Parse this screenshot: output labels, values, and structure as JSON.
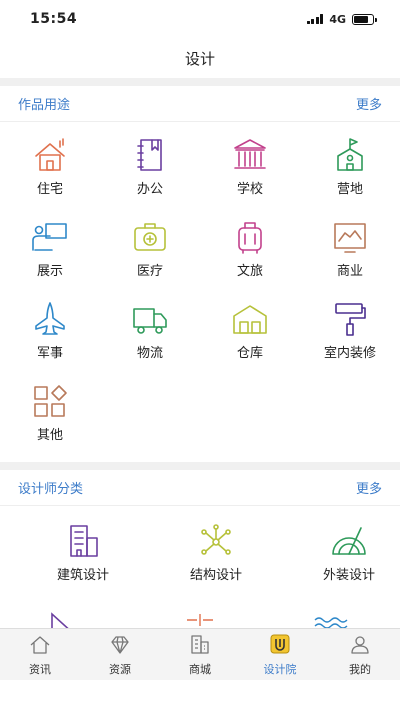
{
  "status_bar": {
    "time": "15:54",
    "network": "4G",
    "battery_level": 0.8
  },
  "nav": {
    "title": "设计"
  },
  "usage_section": {
    "title": "作品用途",
    "more": "更多",
    "items": [
      {
        "label": "住宅",
        "icon": "house-icon",
        "color": "#e0714d"
      },
      {
        "label": "办公",
        "icon": "notebook-icon",
        "color": "#6a3fa0"
      },
      {
        "label": "学校",
        "icon": "school-building-icon",
        "color": "#c2418c"
      },
      {
        "label": "营地",
        "icon": "camp-flag-icon",
        "color": "#2e9a5a"
      },
      {
        "label": "展示",
        "icon": "presentation-icon",
        "color": "#2e88c9"
      },
      {
        "label": "医疗",
        "icon": "medical-kit-icon",
        "color": "#b6c13a"
      },
      {
        "label": "文旅",
        "icon": "luggage-icon",
        "color": "#c2418c"
      },
      {
        "label": "商业",
        "icon": "screen-chart-icon",
        "color": "#b8795a"
      },
      {
        "label": "军事",
        "icon": "jet-icon",
        "color": "#2e88c9"
      },
      {
        "label": "物流",
        "icon": "truck-icon",
        "color": "#2e9a5a"
      },
      {
        "label": "仓库",
        "icon": "warehouse-icon",
        "color": "#b6c13a"
      },
      {
        "label": "室内装修",
        "icon": "paint-roller-icon",
        "color": "#4a2f8f"
      },
      {
        "label": "其他",
        "icon": "grid-squares-icon",
        "color": "#b8795a"
      }
    ]
  },
  "designer_section": {
    "title": "设计师分类",
    "more": "更多",
    "items": [
      {
        "label": "建筑设计",
        "icon": "building-icon",
        "color": "#6a3fa0"
      },
      {
        "label": "结构设计",
        "icon": "structure-nodes-icon",
        "color": "#b6c13a"
      },
      {
        "label": "外装设计",
        "icon": "protractor-icon",
        "color": "#2e9a5a"
      }
    ]
  },
  "tab_bar": {
    "active_color": "#3d7cc9",
    "tabs": [
      {
        "label": "资讯",
        "icon": "home-icon"
      },
      {
        "label": "资源",
        "icon": "diamond-icon"
      },
      {
        "label": "商城",
        "icon": "mall-building-icon"
      },
      {
        "label": "设计院",
        "icon": "design-institute-icon"
      },
      {
        "label": "我的",
        "icon": "user-icon"
      }
    ]
  }
}
